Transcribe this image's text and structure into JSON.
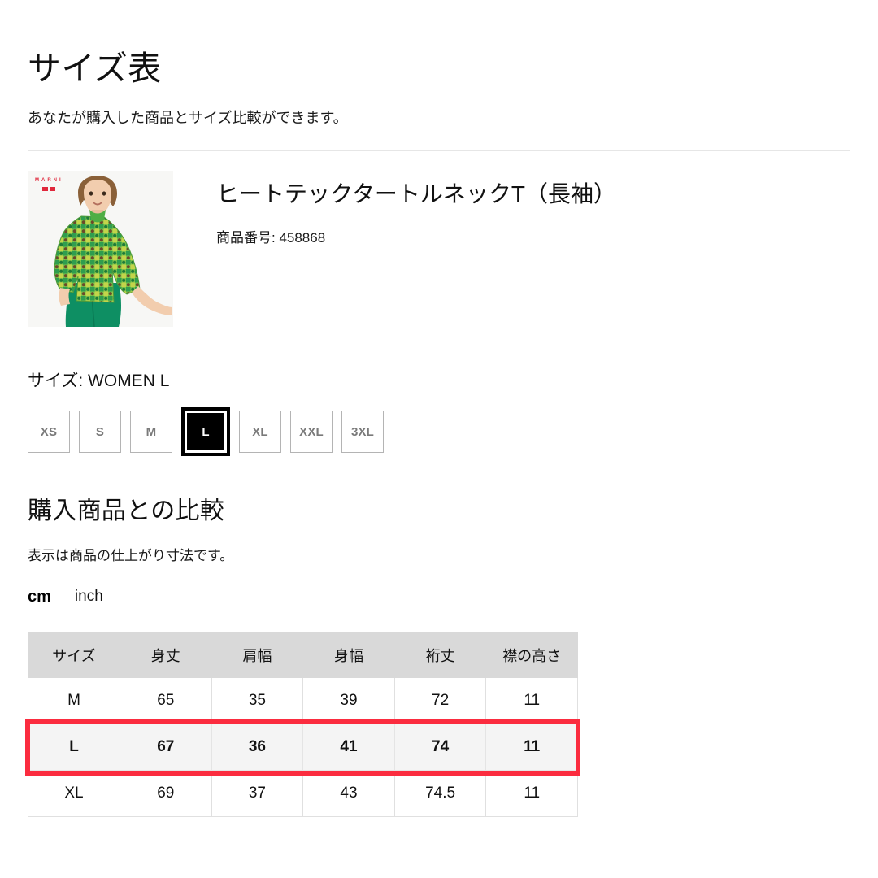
{
  "header": {
    "title": "サイズ表",
    "subtitle": "あなたが購入した商品とサイズ比較ができます。"
  },
  "product": {
    "image_alt": "ヒートテックタートルネックT（長袖）を着たモデル",
    "brand_mark": "MARNI",
    "name": "ヒートテックタートルネックT（長袖）",
    "code_label": "商品番号: 458868"
  },
  "size_selector": {
    "label": "サイズ: WOMEN L",
    "selected": "L",
    "options": [
      "XS",
      "S",
      "M",
      "L",
      "XL",
      "XXL",
      "3XL"
    ]
  },
  "comparison": {
    "title": "購入商品との比較",
    "note": "表示は商品の仕上がり寸法です。",
    "units": {
      "active": "cm",
      "alternate": "inch"
    }
  },
  "table": {
    "columns": [
      "サイズ",
      "身丈",
      "肩幅",
      "身幅",
      "裄丈",
      "襟の高さ"
    ],
    "rows": [
      {
        "size": "M",
        "values": [
          "65",
          "35",
          "39",
          "72",
          "11"
        ],
        "highlighted": false
      },
      {
        "size": "L",
        "values": [
          "67",
          "36",
          "41",
          "74",
          "11"
        ],
        "highlighted": true
      },
      {
        "size": "XL",
        "values": [
          "69",
          "37",
          "43",
          "74.5",
          "11"
        ],
        "highlighted": false
      }
    ]
  },
  "colors": {
    "highlight_red": "#fb2c3f",
    "header_gray": "#d9d9d9",
    "selected_chip": "#000000",
    "brand_red": "#e0283c"
  }
}
